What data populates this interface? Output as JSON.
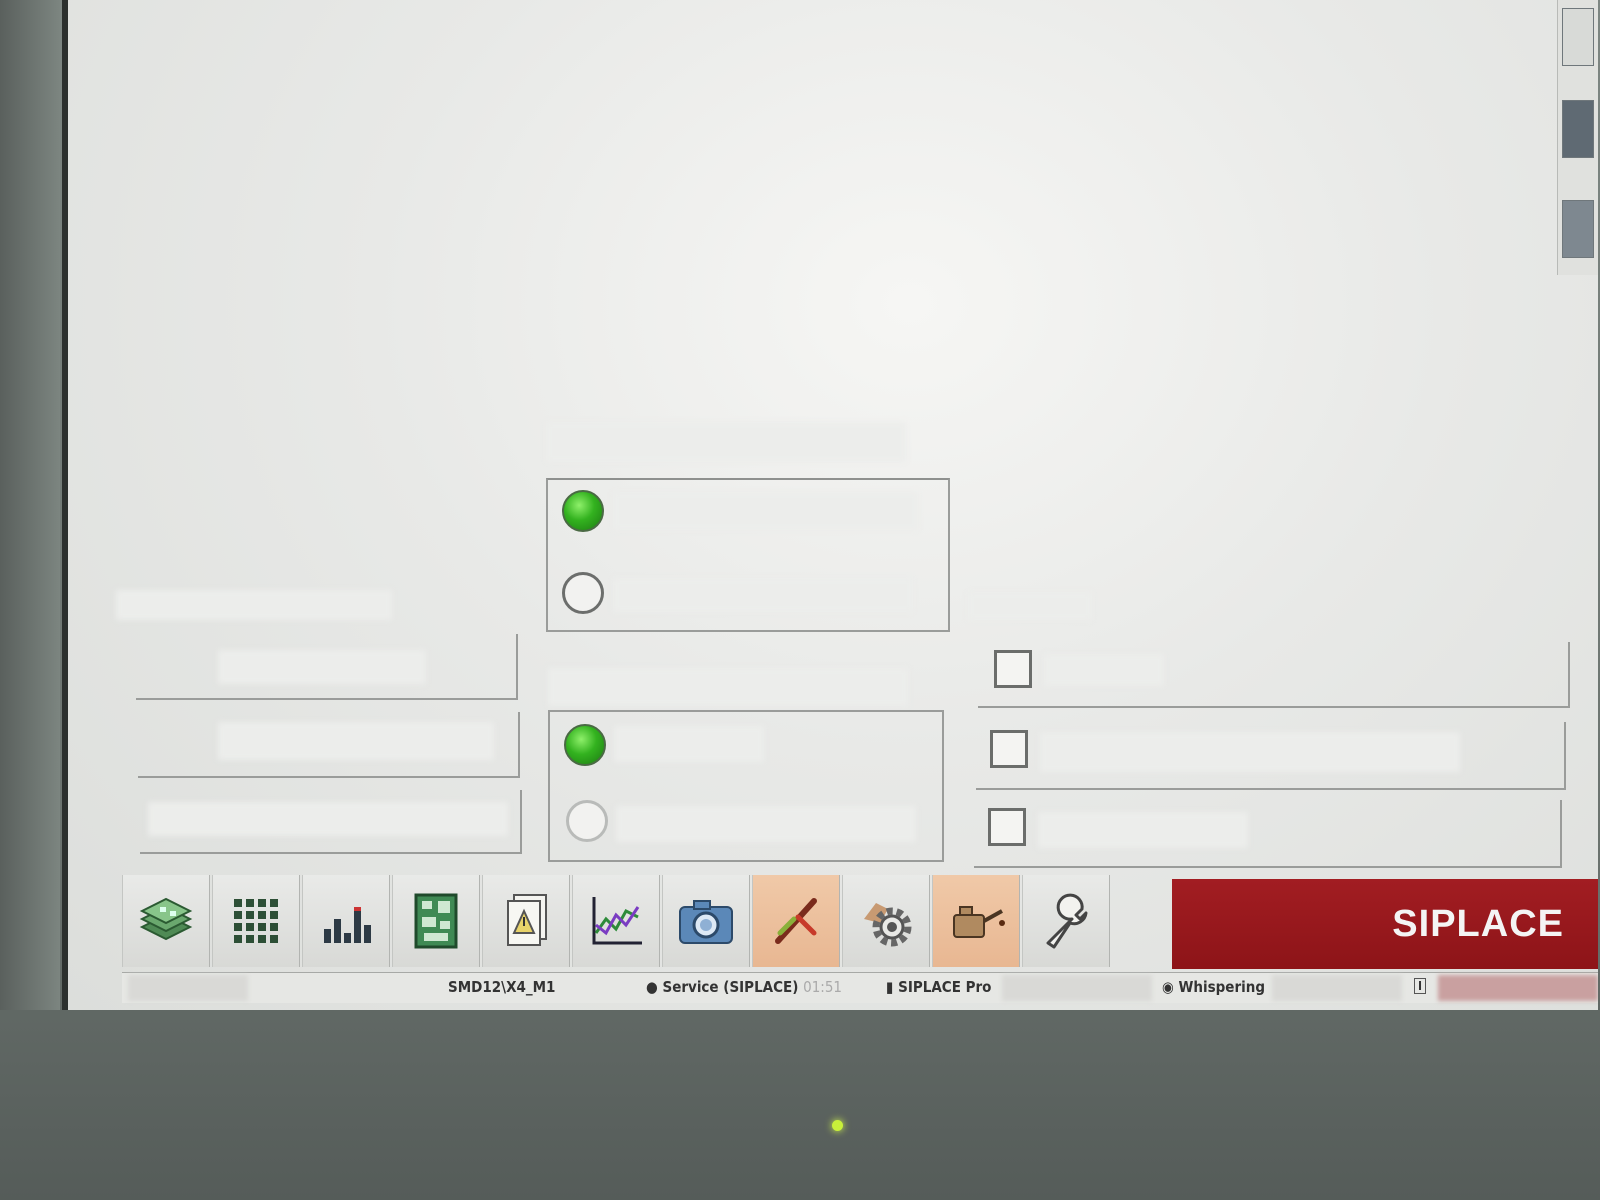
{
  "brand": {
    "logo_text": "SIPLACE"
  },
  "status_bar": {
    "machine": "SMD12\\X4_M1",
    "user": "Service (SIPLACE)",
    "time": "01:51",
    "product": "SIPLACE Pro",
    "mode": "Whispering"
  },
  "toolbar": {
    "buttons": [
      {
        "icon": "boards-stack-icon"
      },
      {
        "icon": "grid-icon"
      },
      {
        "icon": "histogram-icon"
      },
      {
        "icon": "pcb-layout-icon"
      },
      {
        "icon": "documents-warning-icon"
      },
      {
        "icon": "trend-chart-icon"
      },
      {
        "icon": "camera-icon"
      },
      {
        "icon": "tools-icon"
      },
      {
        "icon": "gear-settings-icon"
      },
      {
        "icon": "oil-can-icon"
      },
      {
        "icon": "wrench-icon"
      }
    ]
  },
  "options": {
    "radio_group_1": [
      "selected",
      "unselected"
    ],
    "radio_group_2": [
      "selected",
      "unselected"
    ],
    "checkboxes": [
      false,
      false,
      false
    ]
  },
  "colors": {
    "brand_red": "#9a181d",
    "radio_on": "#33b21f",
    "highlight_button": "#eebf9c"
  }
}
